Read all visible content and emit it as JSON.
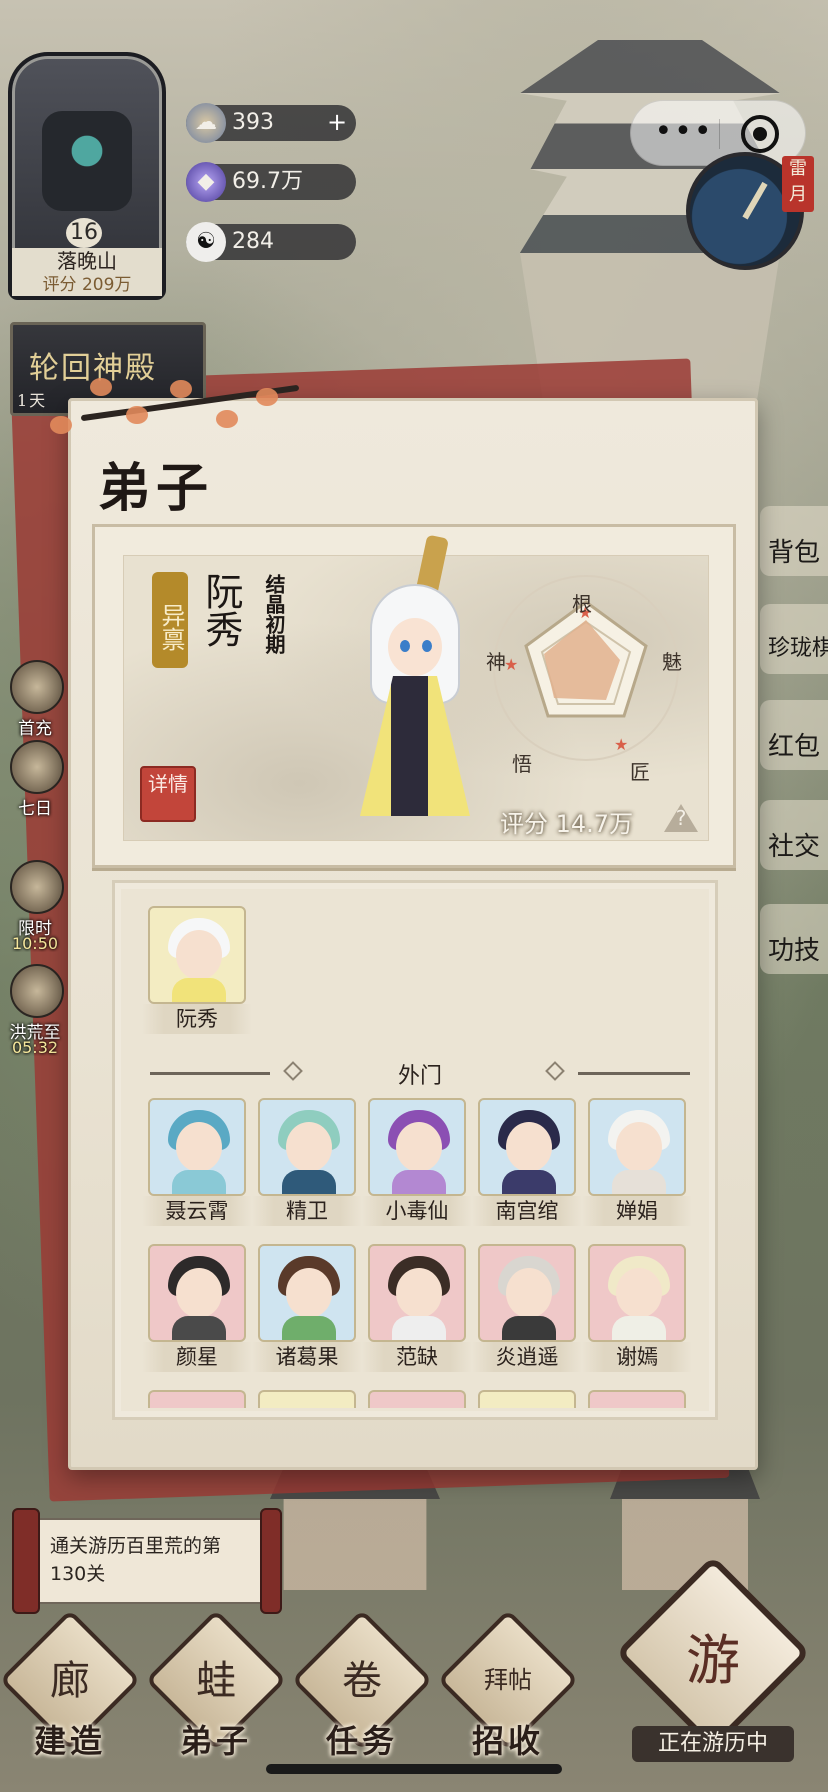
{
  "hud": {
    "sect_level": "16",
    "sect_name": "落晚山",
    "sect_score": "评分 209万",
    "resources": [
      {
        "icon": "spirit-cloud-icon",
        "value": "393",
        "has_plus": true
      },
      {
        "icon": "spirit-stone-icon",
        "value": "69.7万",
        "has_plus": false
      },
      {
        "icon": "yin-yang-icon",
        "value": "284",
        "has_plus": false
      }
    ],
    "event_board_title": "轮回神殿",
    "event_board_timer": "1天",
    "calendar": "雷月"
  },
  "capsule": {
    "more": "•••"
  },
  "side_menu": [
    {
      "label": "背包"
    },
    {
      "label": "珍珑棋局"
    },
    {
      "label": "红包"
    },
    {
      "label": "社交"
    },
    {
      "label": "功技"
    }
  ],
  "left_events": [
    {
      "label": "首充",
      "time": ""
    },
    {
      "label": "七日",
      "time": ""
    },
    {
      "label": "限时",
      "time": "10:50"
    },
    {
      "label": "洪荒至",
      "time": "05:32"
    }
  ],
  "panel": {
    "title": "弟子",
    "selected": {
      "rarity": "异禀",
      "name": "阮秀",
      "realm": "结晶初期",
      "detail_button": "详情",
      "score": "评分 14.7万",
      "help": "?",
      "attributes": [
        "根",
        "魅",
        "匠",
        "悟",
        "神"
      ]
    },
    "leader_slot": {
      "name": "阮秀"
    },
    "section_title": "外门",
    "disciples": [
      {
        "name": "聂云霄",
        "bg": "#cfe4f0",
        "hair": "#5aa9c4",
        "robe": "#8ac9d6"
      },
      {
        "name": "精卫",
        "bg": "#cfe4f0",
        "hair": "#8fcdbf",
        "robe": "#2f5a7a"
      },
      {
        "name": "小毒仙",
        "bg": "#cfe4f0",
        "hair": "#8b4fb3",
        "robe": "#b388d2"
      },
      {
        "name": "南宫绾",
        "bg": "#cfe4f0",
        "hair": "#2a2a4a",
        "robe": "#3b3b6a"
      },
      {
        "name": "婵娟",
        "bg": "#cfe4f0",
        "hair": "#f3f3f0",
        "robe": "#e6e0d8"
      },
      {
        "name": "颜星",
        "bg": "#efc8c8",
        "hair": "#2d2a2a",
        "robe": "#4a4a4a"
      },
      {
        "name": "诸葛果",
        "bg": "#cfe4f0",
        "hair": "#5a3a2a",
        "robe": "#6fae6b"
      },
      {
        "name": "范缺",
        "bg": "#efc8c8",
        "hair": "#3b2d26",
        "robe": "#eeeeee"
      },
      {
        "name": "炎逍遥",
        "bg": "#efc8c8",
        "hair": "#d9d6d0",
        "robe": "#3a3a3a"
      },
      {
        "name": "谢嫣",
        "bg": "#efc8c8",
        "hair": "#f0e9c8",
        "robe": "#efefe6"
      }
    ]
  },
  "quest": {
    "text": "通关游历百里荒的第130关"
  },
  "nav": [
    {
      "label": "建造",
      "glyph": "廊"
    },
    {
      "label": "弟子",
      "glyph": "蛙"
    },
    {
      "label": "任务",
      "glyph": "卷"
    },
    {
      "label": "招收",
      "glyph": "拜帖"
    }
  ],
  "travel": {
    "label": "正在游历中",
    "glyph": "游"
  },
  "colors": {
    "accent_red": "#c2453a",
    "rarity_gold": "#b48a2a",
    "panel_bg": "#efe9dc"
  }
}
